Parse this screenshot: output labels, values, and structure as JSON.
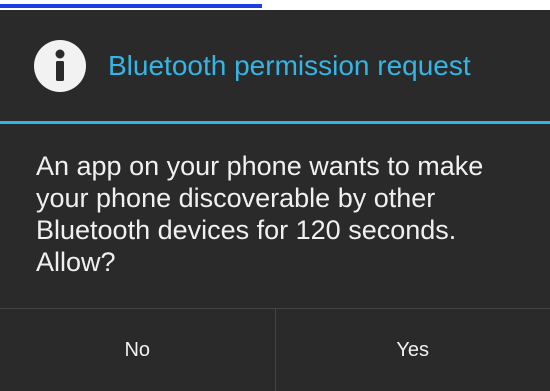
{
  "dialog": {
    "title": "Bluetooth permission request",
    "icon": "info-icon",
    "message": "An app on your phone wants to make your phone discoverable by other Bluetooth devices for 120 seconds. Allow?",
    "buttons": {
      "negative_label": "No",
      "positive_label": "Yes"
    }
  },
  "colors": {
    "accent": "#33b5e5",
    "background": "#2a2a2a",
    "text": "#f0f0f0",
    "link": "#1a3fe0"
  }
}
